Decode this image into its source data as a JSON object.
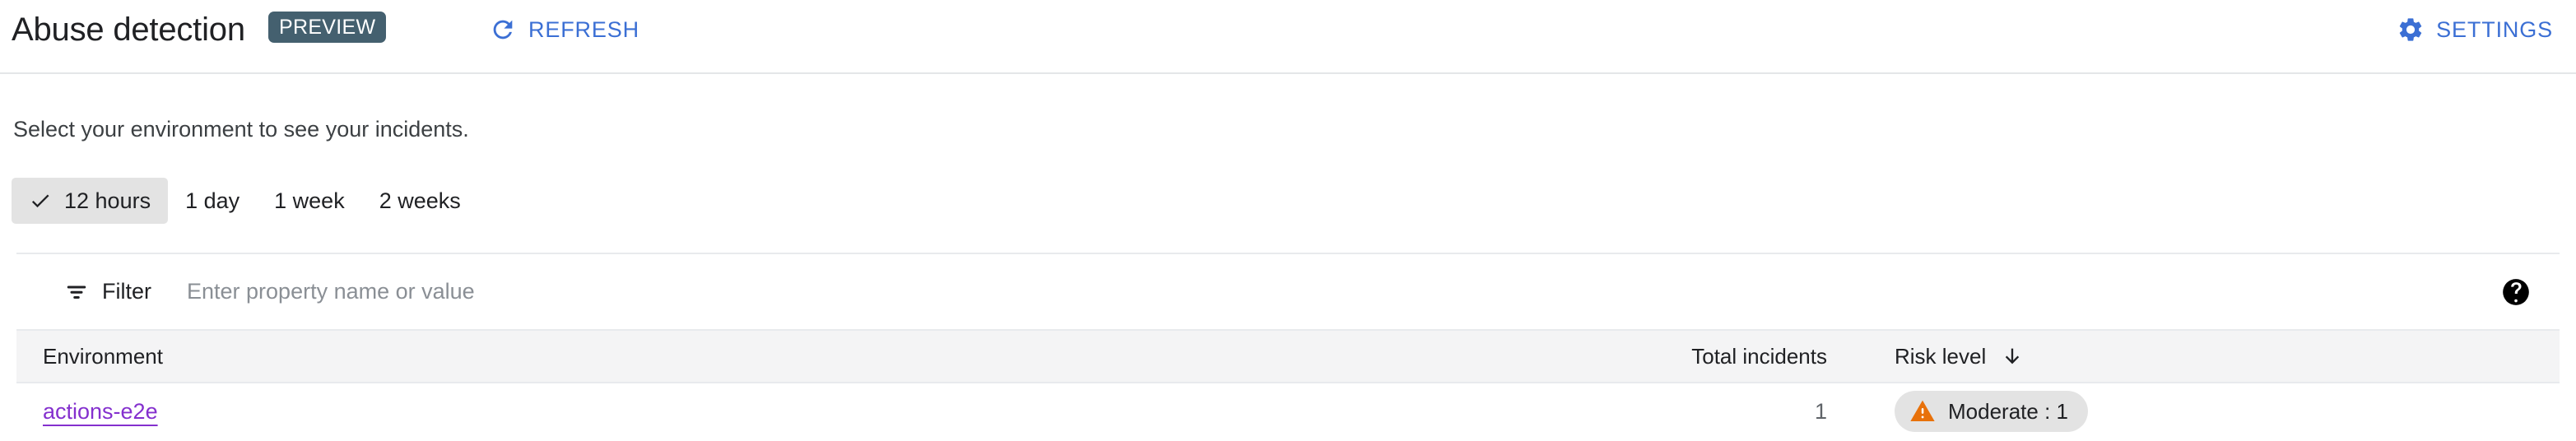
{
  "header": {
    "title": "Abuse detection",
    "preview_badge": "PREVIEW",
    "preview_badge_color": "#44606f",
    "refresh_label": "REFRESH",
    "settings_label": "SETTINGS",
    "action_color": "#3b6fd4",
    "refresh_icon": "refresh-icon",
    "settings_icon": "gear-icon"
  },
  "description": "Select your environment to see your incidents.",
  "time_ranges": {
    "selected": "12 hours",
    "selected_bg": "#e3e3e3",
    "check_icon": "check-icon",
    "options": [
      {
        "label": "12 hours",
        "selected": true
      },
      {
        "label": "1 day",
        "selected": false
      },
      {
        "label": "1 week",
        "selected": false
      },
      {
        "label": "2 weeks",
        "selected": false
      }
    ]
  },
  "filter": {
    "icon": "filter-icon",
    "label": "Filter",
    "placeholder": "Enter property name or value",
    "value": "",
    "help_icon": "help-icon"
  },
  "table": {
    "columns": [
      {
        "label": "Environment",
        "sorted": false
      },
      {
        "label": "Total incidents",
        "sorted": false
      },
      {
        "label": "Risk level",
        "sorted": true,
        "sort_direction": "descending",
        "sort_icon": "arrow-down-icon"
      }
    ],
    "rows": [
      {
        "environment": "actions-e2e",
        "environment_link_color": "#8430ce",
        "total_incidents": "1",
        "risk_level_label": "Moderate : 1",
        "risk_level_icon": "warning-triangle-icon",
        "risk_level_icon_color": "#e8710a",
        "risk_level_pill_color": "#e3e3e3"
      }
    ]
  }
}
